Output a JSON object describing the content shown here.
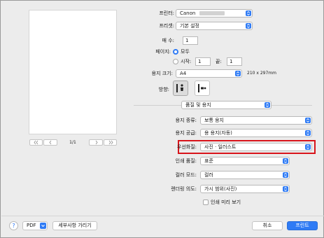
{
  "preview": {
    "page_indicator": "1/1"
  },
  "printer": {
    "label": "프린터:",
    "value": "Canon"
  },
  "presets": {
    "label": "프리셋:",
    "value": "기본 설정"
  },
  "copies": {
    "label": "매 수:",
    "value": "1"
  },
  "pages": {
    "label": "페이지:",
    "all_label": "모두",
    "from_label": "시작:",
    "from_value": "1",
    "to_label": "끝:",
    "to_value": "1"
  },
  "paper_size": {
    "label": "용지 크기:",
    "value": "A4",
    "dimensions": "210 x 297mm"
  },
  "orientation": {
    "label": "방향:"
  },
  "panel_select": {
    "value": "품질 및 용지"
  },
  "media_type": {
    "label": "용지 종류:",
    "value": "보통 용지"
  },
  "paper_source": {
    "label": "용지 공급:",
    "value": "용 용지(자동)"
  },
  "priority": {
    "label": "우선화질:",
    "value": "사진 · 일러스트"
  },
  "print_quality": {
    "label": "인쇄 품질:",
    "value": "표준"
  },
  "color_mode": {
    "label": "컬러 모드:",
    "value": "컬러"
  },
  "rendering_intent": {
    "label": "렌더링 의도:",
    "value": "가시 범위(사진)"
  },
  "print_preview": {
    "label": "인쇄 미리 보기"
  },
  "footer": {
    "help_icon_text": "?",
    "pdf_label": "PDF",
    "hide_details_label": "세부사항 가리기",
    "cancel_label": "취소",
    "print_label": "프린트"
  },
  "colors": {
    "accent": "#2f7bf5",
    "highlight": "#d8141b"
  },
  "icons": {
    "popup": "updown-chevron-icon",
    "first_page": "first-page-icon",
    "prev_page": "prev-page-icon",
    "next_page": "next-page-icon",
    "last_page": "last-page-icon",
    "help": "help-icon",
    "pdf_menu": "chevron-down-icon"
  }
}
